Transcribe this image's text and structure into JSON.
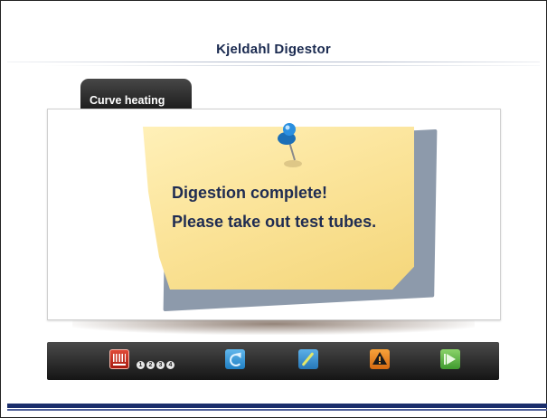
{
  "header": {
    "title": "Kjeldahl Digestor"
  },
  "tab": {
    "label": "Curve heating"
  },
  "note": {
    "line1": "Digestion complete!",
    "line2": "Please take out test tubes."
  },
  "toolbar": {
    "heater_icon": "heater-icon",
    "stage_indicators": [
      "1",
      "2",
      "3",
      "4"
    ],
    "refresh_icon": "refresh-icon",
    "tool_icon": "tool-icon",
    "warning_icon": "warning-icon",
    "play_icon": "play-icon"
  },
  "colors": {
    "title": "#1a2a50",
    "note_text": "#1f2c52",
    "note_paper": "#fbe49a",
    "toolbar": "#2a2a2a",
    "bottom_band": "#1a2d6b"
  }
}
